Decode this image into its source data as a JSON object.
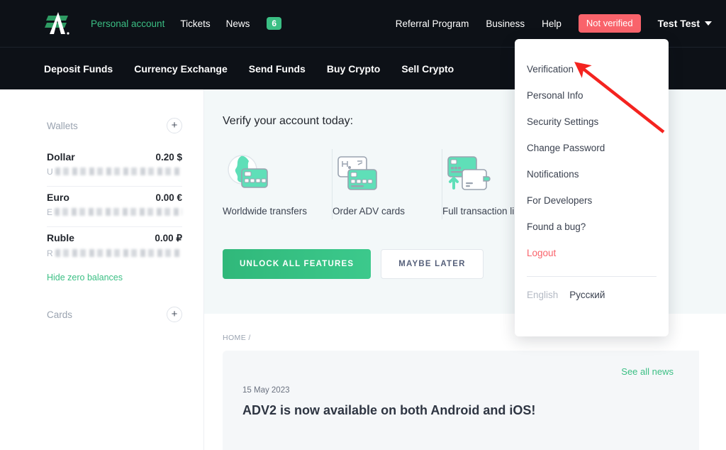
{
  "topnav": {
    "logo_icon": "adv-logo-icon",
    "left_links": [
      {
        "label": "Personal account",
        "active": true
      },
      {
        "label": "Tickets",
        "active": false
      },
      {
        "label": "News",
        "active": false
      }
    ],
    "news_badge": "6",
    "right_links": [
      {
        "label": "Referral Program"
      },
      {
        "label": "Business"
      },
      {
        "label": "Help"
      }
    ],
    "status_badge": "Not verified",
    "user_name": "Test Test",
    "caret_icon": "chevron-down-icon"
  },
  "subnav": {
    "links": [
      {
        "label": "Deposit Funds"
      },
      {
        "label": "Currency Exchange"
      },
      {
        "label": "Send Funds"
      },
      {
        "label": "Buy Crypto"
      },
      {
        "label": "Sell Crypto"
      }
    ]
  },
  "sidebar": {
    "wallets_title": "Wallets",
    "wallets_add_icon": "plus-icon",
    "wallets": [
      {
        "name": "Dollar",
        "amount": "0.20 $",
        "account_prefix": "U",
        "account_masked": true
      },
      {
        "name": "Euro",
        "amount": "0.00 €",
        "account_prefix": "E",
        "account_masked": true
      },
      {
        "name": "Ruble",
        "amount": "0.00 ₽",
        "account_prefix": "R",
        "account_masked": true
      }
    ],
    "hide_zero_label": "Hide zero balances",
    "cards_title": "Cards",
    "cards_add_icon": "plus-icon"
  },
  "verify_panel": {
    "title": "Verify your account today:",
    "features": [
      {
        "label": "Worldwide transfers",
        "icon": "globe-card-icon"
      },
      {
        "label": "Order ADV cards",
        "icon": "cards-stack-icon"
      },
      {
        "label": "Full transaction li",
        "icon": "card-wallet-icon"
      }
    ],
    "primary_button": "UNLOCK ALL FEATURES",
    "secondary_button": "MAYBE LATER"
  },
  "news_section": {
    "breadcrumb": "HOME /",
    "see_all_label": "See all news",
    "date": "15 May 2023",
    "title": "ADV2 is now available on both Android and iOS!"
  },
  "dropdown": {
    "items": [
      {
        "label": "Verification",
        "style": "normal"
      },
      {
        "label": "Personal Info",
        "style": "normal"
      },
      {
        "label": "Security Settings",
        "style": "normal"
      },
      {
        "label": "Change Password",
        "style": "normal"
      },
      {
        "label": "Notifications",
        "style": "normal"
      },
      {
        "label": "For Developers",
        "style": "normal"
      },
      {
        "label": "Found a bug?",
        "style": "normal"
      },
      {
        "label": "Logout",
        "style": "logout"
      }
    ],
    "lang_en": "English",
    "lang_ru": "Русский"
  },
  "annotation": {
    "arrow_icon": "red-arrow-pointer",
    "arrow_color": "#f4231f"
  },
  "colors": {
    "nav_bg": "#0d1117",
    "brand_green": "#3bbf84",
    "danger_red": "#f9636b",
    "panel_bg": "#f3f8f9",
    "text_dark": "#23272e",
    "text_muted": "#9aa3b0"
  }
}
